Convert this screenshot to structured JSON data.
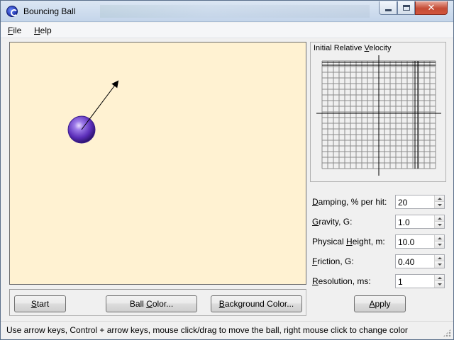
{
  "window": {
    "title": "Bouncing Ball",
    "icon": "bouncing-ball-app-icon",
    "controls": {
      "minimize_icon": "minimize-icon",
      "maximize_icon": "maximize-icon",
      "close_label": "✕"
    }
  },
  "menu": {
    "file": {
      "label": "File",
      "mnemonic": "F",
      "rest": "ile"
    },
    "help": {
      "label": "Help",
      "mnemonic": "H",
      "rest": "elp"
    }
  },
  "canvas": {
    "background_color": "#fff2d2",
    "ball": {
      "color": "#5a2db8",
      "highlight": "#c9b3ff",
      "shape": "sphere"
    },
    "velocity_arrow": {
      "color": "#000000"
    }
  },
  "buttons": {
    "start": {
      "mnemonic": "S",
      "rest": "tart",
      "label": "Start"
    },
    "ball_color": {
      "pre": "Ball ",
      "mnemonic": "C",
      "rest": "olor...",
      "label": "Ball Color..."
    },
    "background_color": {
      "mnemonic": "B",
      "rest": "ackground Color...",
      "label": "Background Color..."
    },
    "apply": {
      "mnemonic": "A",
      "rest": "pply",
      "label": "Apply"
    }
  },
  "velocity_panel": {
    "title_pre": "Initial Relative ",
    "title_mnemonic": "V",
    "title_rest": "elocity",
    "title": "Initial Relative Velocity"
  },
  "settings": [
    {
      "label": "Damping, % per hit:",
      "mnemonic": "D",
      "rest": "amping, % per hit:",
      "value": "20"
    },
    {
      "label": "Gravity, G:",
      "mnemonic": "G",
      "rest": "ravity, G:",
      "value": "1.0"
    },
    {
      "label": "Physical Height, m:",
      "pre": "Physical ",
      "mnemonic": "H",
      "rest": "eight, m:",
      "value": "10.0"
    },
    {
      "label": "Friction, G:",
      "mnemonic": "F",
      "rest": "riction, G:",
      "value": "0.40"
    },
    {
      "label": "Resolution, ms:",
      "mnemonic": "R",
      "rest": "esolution, ms:",
      "value": "1"
    }
  ],
  "status": {
    "text": "Use arrow keys, Control + arrow keys, mouse click/drag to move the ball, right mouse click to change color"
  }
}
